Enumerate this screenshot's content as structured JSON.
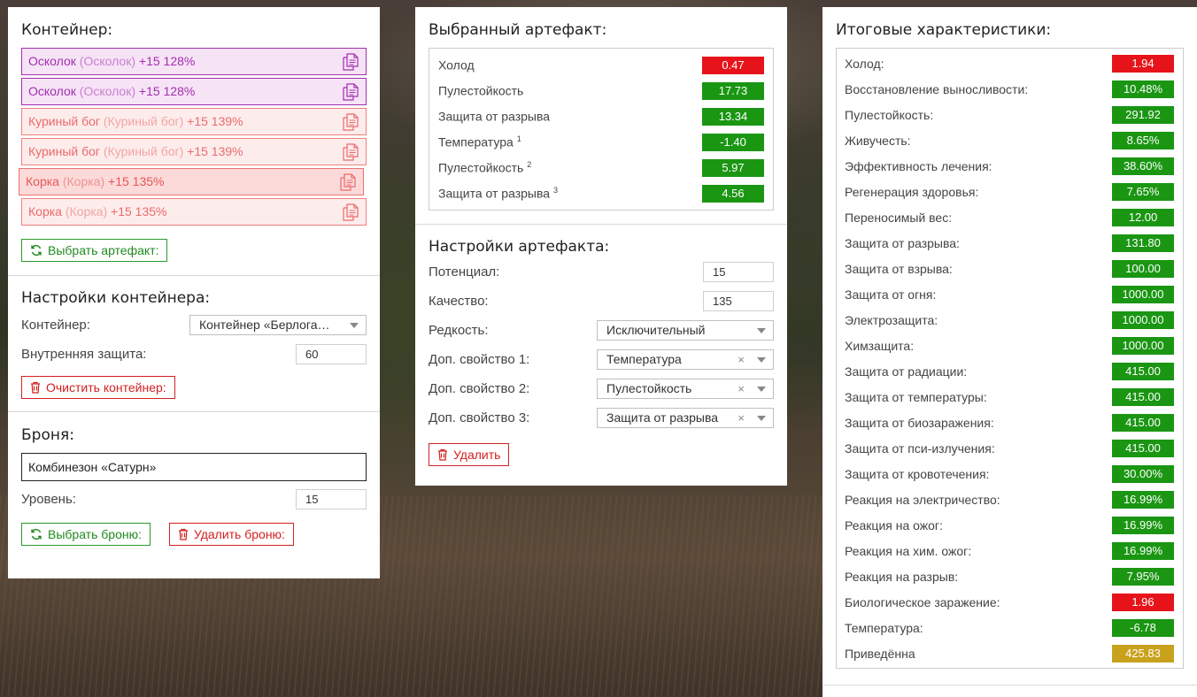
{
  "container": {
    "title": "Контейнер:",
    "slots": [
      {
        "name": "Осколок",
        "alt": "(Осколок)",
        "bonus": "+15 128%",
        "style": "purple"
      },
      {
        "name": "Осколок",
        "alt": "(Осколок)",
        "bonus": "+15 128%",
        "style": "purple"
      },
      {
        "name": "Куриный бог",
        "alt": "(Куриный бог)",
        "bonus": "+15 139%",
        "style": "pink"
      },
      {
        "name": "Куриный бог",
        "alt": "(Куриный бог)",
        "bonus": "+15 139%",
        "style": "pink"
      },
      {
        "name": "Корка",
        "alt": "(Корка)",
        "bonus": "+15 135%",
        "style": "red"
      },
      {
        "name": "Корка",
        "alt": "(Корка)",
        "bonus": "+15 135%",
        "style": "pink"
      }
    ],
    "select_artifact_label": "Выбрать артефакт:"
  },
  "container_settings": {
    "title": "Настройки контейнера:",
    "container_label": "Контейнер:",
    "container_value": "Контейнер «Берлога…",
    "inner_protection_label": "Внутренняя защита:",
    "inner_protection_value": "60",
    "clear_label": "Очистить контейнер:"
  },
  "armor": {
    "title": "Броня:",
    "name": "Комбинезон «Сатурн»",
    "level_label": "Уровень:",
    "level_value": "15",
    "select_label": "Выбрать броню:",
    "delete_label": "Удалить броню:"
  },
  "selected_artifact": {
    "title": "Выбранный артефакт:",
    "stats": [
      {
        "label": "Холод",
        "sup": "",
        "value": "0.47",
        "color": "red"
      },
      {
        "label": "Пулестойкость",
        "sup": "",
        "value": "17.73",
        "color": "green"
      },
      {
        "label": "Защита от разрыва",
        "sup": "",
        "value": "13.34",
        "color": "green"
      },
      {
        "label": "Температура",
        "sup": "1",
        "value": "-1.40",
        "color": "green"
      },
      {
        "label": "Пулестойкость",
        "sup": "2",
        "value": "5.97",
        "color": "green"
      },
      {
        "label": "Защита от разрыва",
        "sup": "3",
        "value": "4.56",
        "color": "green"
      }
    ]
  },
  "artifact_settings": {
    "title": "Настройки артефакта:",
    "potential_label": "Потенциал:",
    "potential_value": "15",
    "quality_label": "Качество:",
    "quality_value": "135",
    "rarity_label": "Редкость:",
    "rarity_value": "Исключительный",
    "extra1_label": "Доп. свойство 1:",
    "extra1_value": "Температура",
    "extra2_label": "Доп. свойство 2:",
    "extra2_value": "Пулестойкость",
    "extra3_label": "Доп. свойство 3:",
    "extra3_value": "Защита от разрыва",
    "clear_symbol": "×",
    "delete_label": "Удалить"
  },
  "totals": {
    "title": "Итоговые характеристики:",
    "stats": [
      {
        "label": "Холод:",
        "value": "1.94",
        "color": "red"
      },
      {
        "label": "Восстановление выносливости:",
        "value": "10.48%",
        "color": "green"
      },
      {
        "label": "Пулестойкость:",
        "value": "291.92",
        "color": "green"
      },
      {
        "label": "Живучесть:",
        "value": "8.65%",
        "color": "green"
      },
      {
        "label": "Эффективность лечения:",
        "value": "38.60%",
        "color": "green"
      },
      {
        "label": "Регенерация здоровья:",
        "value": "7.65%",
        "color": "green"
      },
      {
        "label": "Переносимый вес:",
        "value": "12.00",
        "color": "green"
      },
      {
        "label": "Защита от разрыва:",
        "value": "131.80",
        "color": "green"
      },
      {
        "label": "Защита от взрыва:",
        "value": "100.00",
        "color": "green"
      },
      {
        "label": "Защита от огня:",
        "value": "1000.00",
        "color": "green"
      },
      {
        "label": "Электрозащита:",
        "value": "1000.00",
        "color": "green"
      },
      {
        "label": "Химзащита:",
        "value": "1000.00",
        "color": "green"
      },
      {
        "label": "Защита от радиации:",
        "value": "415.00",
        "color": "green"
      },
      {
        "label": "Защита от температуры:",
        "value": "415.00",
        "color": "green"
      },
      {
        "label": "Защита от биозаражения:",
        "value": "415.00",
        "color": "green"
      },
      {
        "label": "Защита от пси-излучения:",
        "value": "415.00",
        "color": "green"
      },
      {
        "label": "Защита от кровотечения:",
        "value": "30.00%",
        "color": "green"
      },
      {
        "label": "Реакция на электричество:",
        "value": "16.99%",
        "color": "green"
      },
      {
        "label": "Реакция на ожог:",
        "value": "16.99%",
        "color": "green"
      },
      {
        "label": "Реакция на хим. ожог:",
        "value": "16.99%",
        "color": "green"
      },
      {
        "label": "Реакция на разрыв:",
        "value": "7.95%",
        "color": "green"
      },
      {
        "label": "Биологическое заражение:",
        "value": "1.96",
        "color": "red"
      },
      {
        "label": "Температура:",
        "value": "-6.78",
        "color": "green"
      },
      {
        "label": "Приведённа",
        "value": "425.83",
        "color": "gold"
      }
    ]
  },
  "colors": {
    "green": "#1a9613",
    "red": "#e6141a",
    "gold": "#c9a21d",
    "purple_slot": "#a22fae",
    "red_slot": "#ea6a6a"
  },
  "icons": {
    "slot": "documents-icon",
    "refresh": "refresh-icon",
    "trash": "trash-icon",
    "dropdown": "chevron-down-icon"
  }
}
